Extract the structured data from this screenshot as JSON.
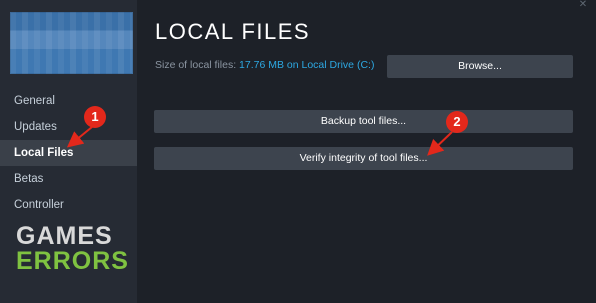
{
  "sidebar": {
    "items": [
      {
        "label": "General",
        "active": false
      },
      {
        "label": "Updates",
        "active": false
      },
      {
        "label": "Local Files",
        "active": true
      },
      {
        "label": "Betas",
        "active": false
      },
      {
        "label": "Controller",
        "active": false
      }
    ]
  },
  "watermark": {
    "line1": "GAMES",
    "line2": "ERRORS"
  },
  "main": {
    "title": "LOCAL FILES",
    "size_label": "Size of local files:",
    "size_value": "17.76 MB on Local Drive (C:)",
    "browse_label": "Browse...",
    "backup_label": "Backup tool files...",
    "verify_label": "Verify integrity of tool files..."
  },
  "window": {
    "close_glyph": "✕"
  },
  "annotations": [
    {
      "number": "1",
      "color": "#e3281b"
    },
    {
      "number": "2",
      "color": "#e3281b"
    }
  ]
}
